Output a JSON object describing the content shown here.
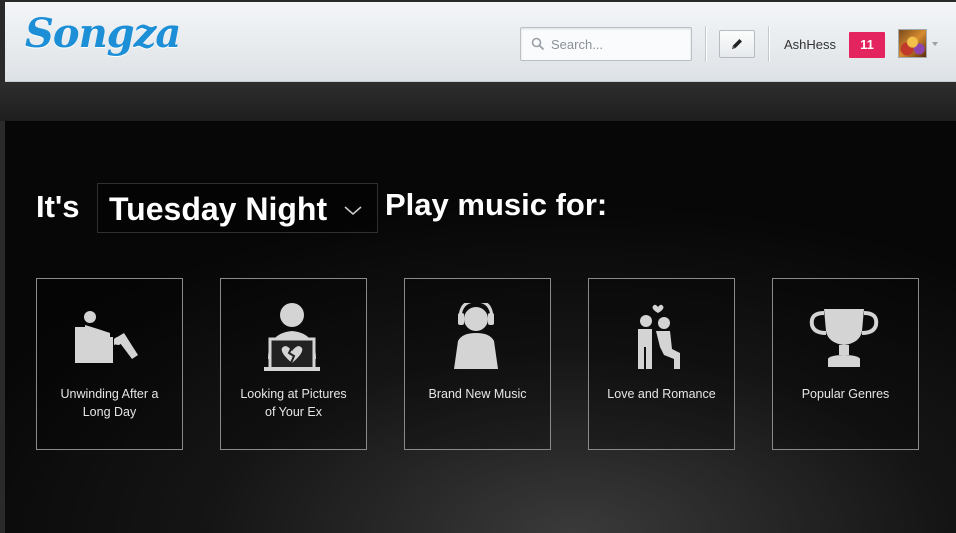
{
  "header": {
    "logo": "Songza",
    "search_placeholder": "Search...",
    "username": "AshHess",
    "notification_count": "11"
  },
  "main": {
    "prefix": "It's",
    "time_selected": "Tuesday Night",
    "suffix": "Play music for:",
    "tiles": [
      {
        "label_line1": "Unwinding After a",
        "label_line2": "Long Day",
        "icon": "recliner-icon"
      },
      {
        "label_line1": "Looking at Pictures",
        "label_line2": "of Your Ex",
        "icon": "broken-heart-laptop-icon"
      },
      {
        "label_line1": "Brand New Music",
        "label_line2": "",
        "icon": "headphones-person-icon"
      },
      {
        "label_line1": "Love and Romance",
        "label_line2": "",
        "icon": "couple-kneeling-icon"
      },
      {
        "label_line1": "Popular Genres",
        "label_line2": "",
        "icon": "trophy-icon"
      }
    ]
  },
  "colors": {
    "brand_blue": "#1d8fd6",
    "badge_pink": "#e4245e",
    "icon_gray": "#d4d4d4"
  }
}
